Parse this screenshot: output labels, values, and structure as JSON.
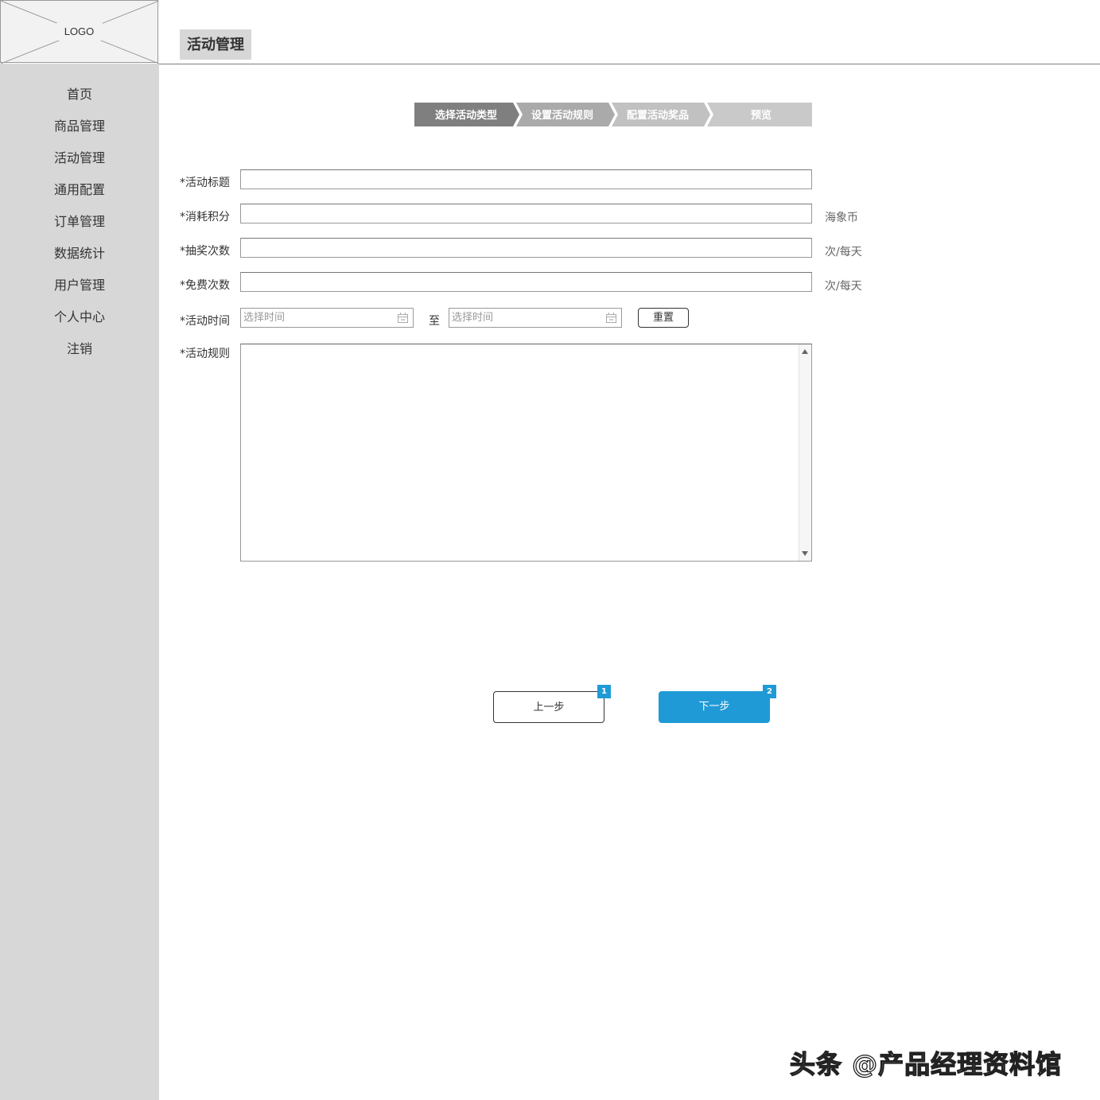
{
  "logo": {
    "text": "LOGO"
  },
  "header": {
    "title": "活动管理"
  },
  "sidebar": {
    "items": [
      {
        "label": "首页"
      },
      {
        "label": "商品管理"
      },
      {
        "label": "活动管理"
      },
      {
        "label": "通用配置"
      },
      {
        "label": "订单管理"
      },
      {
        "label": "数据统计"
      },
      {
        "label": "用户管理"
      },
      {
        "label": "个人中心"
      },
      {
        "label": "注销"
      }
    ]
  },
  "steps": [
    {
      "label": "选择活动类型",
      "state": "active",
      "color": "#7f7f7f"
    },
    {
      "label": "设置活动规则",
      "state": "pending",
      "color": "#aaaaaa"
    },
    {
      "label": "配置活动奖品",
      "state": "pending",
      "color": "#c1c1c1"
    },
    {
      "label": "预览",
      "state": "pending",
      "color": "#c9c9c9"
    }
  ],
  "form": {
    "title_label": "*活动标题",
    "title_value": "",
    "points_label": "*消耗积分",
    "points_value": "",
    "points_unit": "海象币",
    "draws_label": "*抽奖次数",
    "draws_value": "",
    "draws_unit": "次/每天",
    "free_label": "*免费次数",
    "free_value": "",
    "free_unit": "次/每天",
    "time_label": "*活动时间",
    "start_placeholder": "选择时间",
    "to_text": "至",
    "end_placeholder": "选择时间",
    "reset_label": "重置",
    "rules_label": "*活动规则",
    "rules_value": ""
  },
  "actions": {
    "prev_label": "上一步",
    "prev_badge": "1",
    "next_label": "下一步",
    "next_badge": "2"
  },
  "watermark": "头条 @产品经理资料馆",
  "colors": {
    "sidebar_bg": "#d7d7d7",
    "primary": "#1f9ad6",
    "step_active": "#7f7f7f"
  }
}
